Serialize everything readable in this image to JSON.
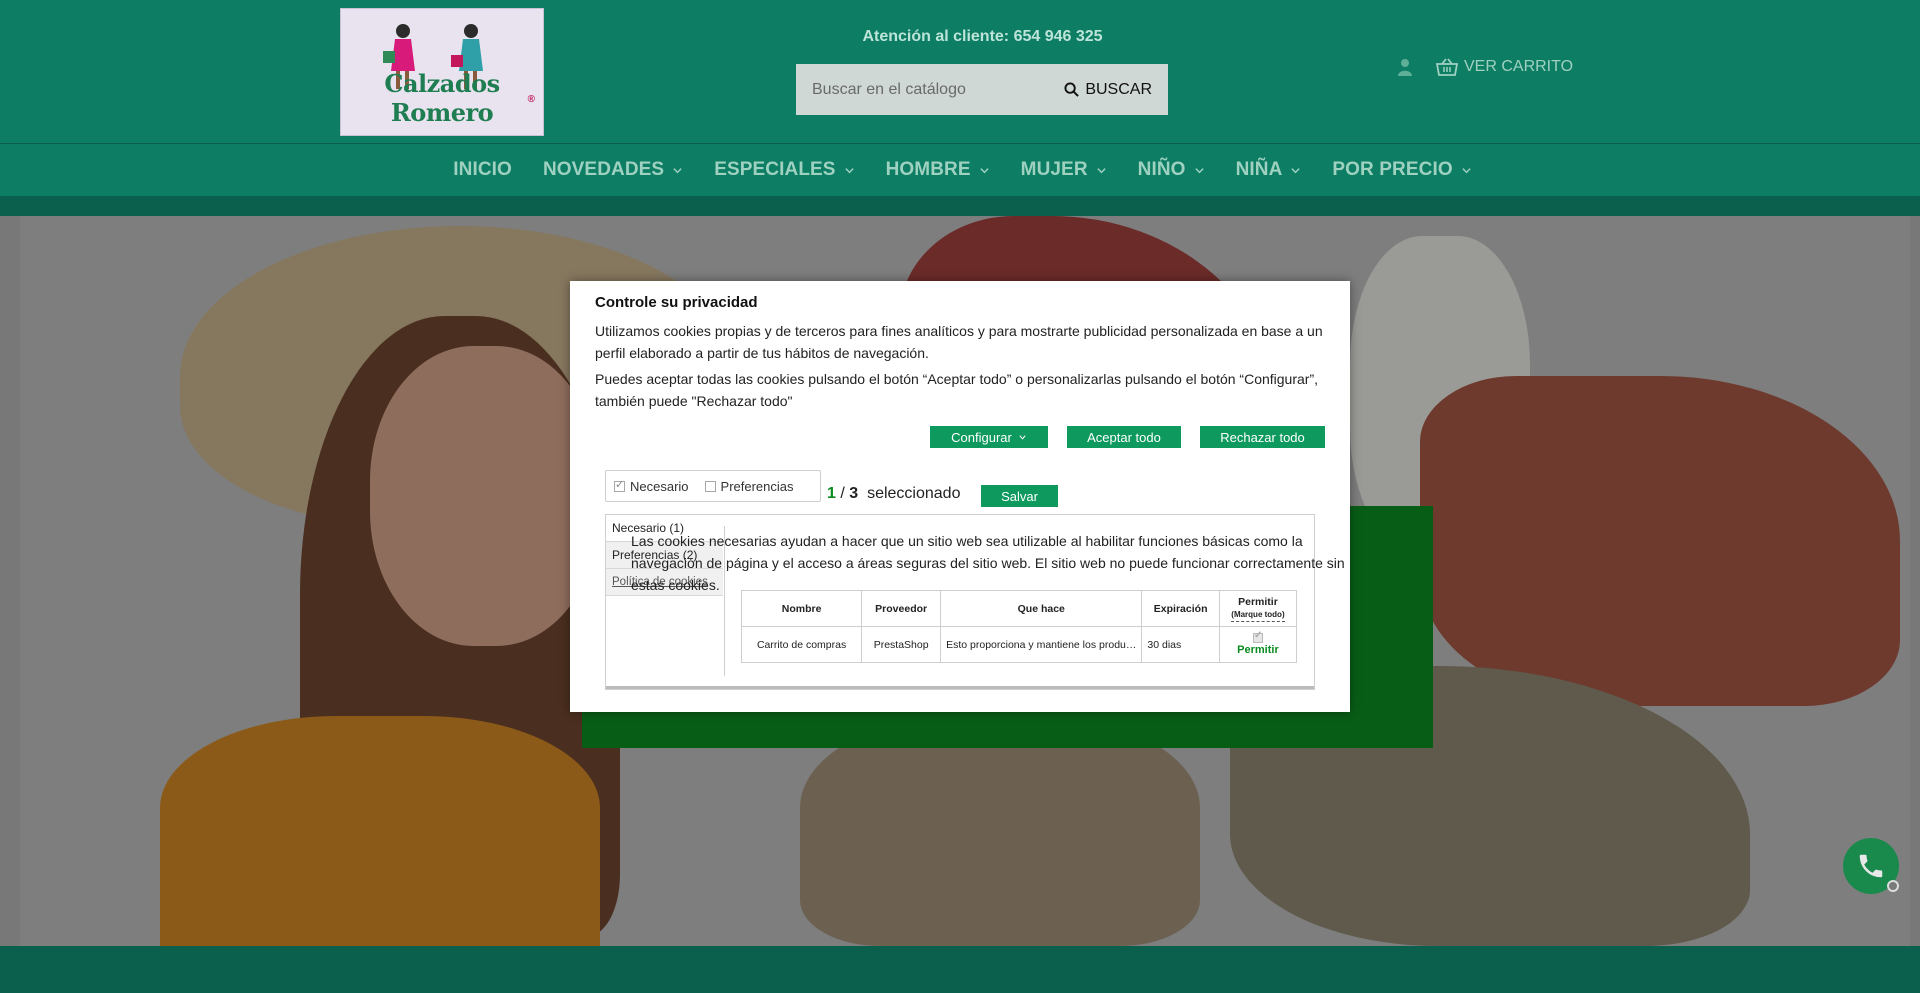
{
  "header": {
    "brand": "Calzados Romero",
    "brand_reg": "®",
    "support_text": "Atención al cliente: 654 946 325",
    "search": {
      "placeholder": "Buscar en el catálogo",
      "button_label": "BUSCAR"
    },
    "cart_label": "VER CARRITO",
    "colors": {
      "header_bg": "#0d7d64",
      "nav_text": "#9fd1c1"
    }
  },
  "nav": {
    "items": [
      {
        "label": "INICIO",
        "dropdown": false
      },
      {
        "label": "NOVEDADES",
        "dropdown": true
      },
      {
        "label": "ESPECIALES",
        "dropdown": true
      },
      {
        "label": "HOMBRE",
        "dropdown": true
      },
      {
        "label": "MUJER",
        "dropdown": true
      },
      {
        "label": "NIÑO",
        "dropdown": true
      },
      {
        "label": "NIÑA",
        "dropdown": true
      },
      {
        "label": "POR PRECIO",
        "dropdown": true
      }
    ]
  },
  "cookie_modal": {
    "title": "Controle su privacidad",
    "paragraph1": "Utilizamos cookies propias y de terceros para fines analíticos y para mostrarte publicidad personalizada en base a un perfil elaborado a partir de tus hábitos de navegación.",
    "paragraph2": "Puedes aceptar todas las cookies pulsando el botón “Aceptar todo” o personalizarlas pulsando el botón “Configurar”, también puede \"Rechazar todo\"",
    "buttons": {
      "configure": "Configurar",
      "accept_all": "Aceptar todo",
      "reject_all": "Rechazar todo",
      "save": "Salvar"
    },
    "checkboxes": [
      {
        "label": "Necesario",
        "checked": true
      },
      {
        "label": "Preferencias",
        "checked": false
      }
    ],
    "selected_count": "1",
    "selected_sep": "/",
    "selected_total": "3",
    "selected_text": "seleccionado",
    "tabs": [
      "Necesario (1)",
      "Preferencias (2)",
      "Política de cookies"
    ],
    "description": "Las cookies necesarias ayudan a hacer que un sitio web sea utilizable al habilitar funciones básicas como la navegación de página y el acceso a áreas seguras del sitio web. El sitio web no puede funcionar correctamente sin estas cookies.",
    "table": {
      "headers": [
        "Nombre",
        "Proveedor",
        "Que hace",
        "Expiración",
        "Permitir"
      ],
      "allow_all_hint": "(Marque todo)",
      "rows": [
        {
          "name": "Carrito de compras",
          "provider": "PrestaShop",
          "what": "Esto proporciona y mantiene los produ…",
          "expiration": "30 dias",
          "allow": "Permitir"
        }
      ]
    },
    "accent_color": "#0e9a5e"
  }
}
